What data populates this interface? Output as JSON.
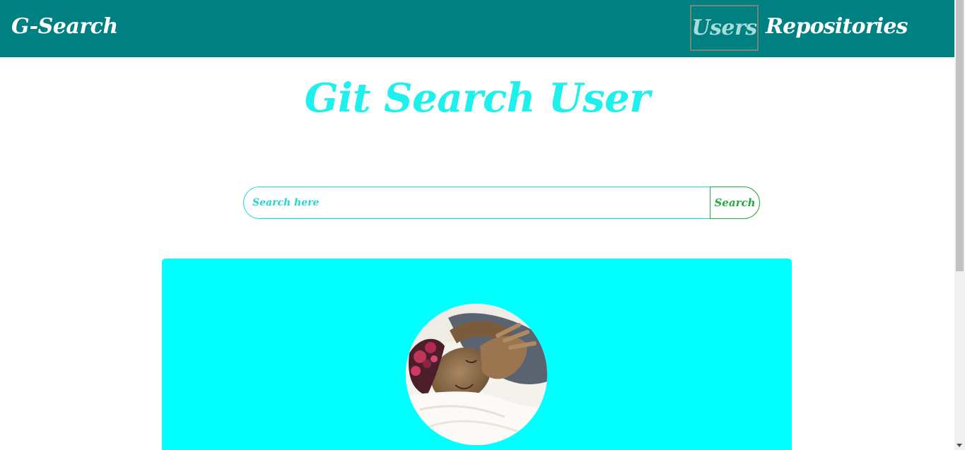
{
  "navbar": {
    "brand": "G-Search",
    "links": [
      {
        "label": "Users",
        "active": true
      },
      {
        "label": "Repositories",
        "active": false
      }
    ],
    "background_color": "#008080"
  },
  "main": {
    "title": "Git Search User",
    "title_color": "#1ef0ee",
    "search": {
      "placeholder": "Search here",
      "value": "",
      "button_label": "Search"
    }
  },
  "user_card": {
    "background_color": "#00ffff",
    "avatar": "user-avatar-photo"
  }
}
